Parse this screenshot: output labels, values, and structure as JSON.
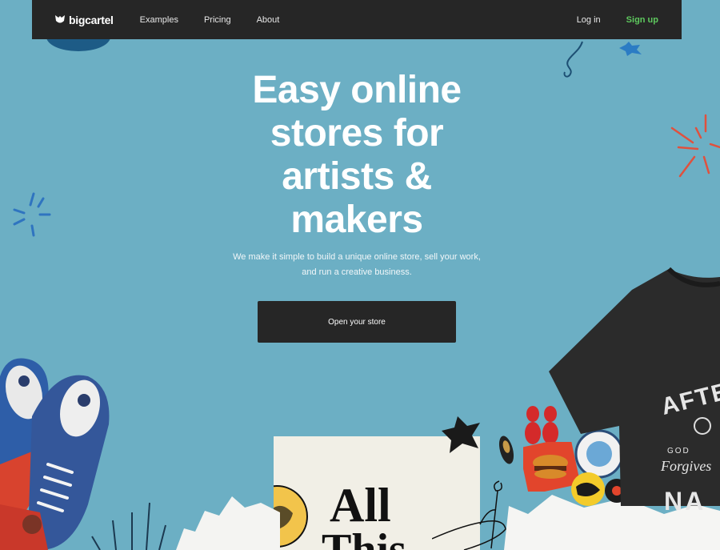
{
  "nav": {
    "logo_text": "bigcartel",
    "links": [
      "Examples",
      "Pricing",
      "About"
    ],
    "login": "Log in",
    "signup": "Sign up"
  },
  "hero": {
    "title_lines": [
      "Easy online",
      "stores for",
      "artists &",
      "makers"
    ],
    "subtitle_lines": [
      "We make it simple to build a unique online store, sell your work,",
      "and run a creative business."
    ],
    "cta": "Open your store"
  },
  "illustration": {
    "tshirt_text_1": "AFTE",
    "tshirt_text_2": "GOD",
    "tshirt_text_3": "Forgives",
    "tshirt_text_4": "NA",
    "poster_text_1": "All",
    "poster_text_2": "This"
  },
  "colors": {
    "background": "#6cafc4",
    "nav_bg": "#262626",
    "signup": "#5ec95e",
    "cta_bg": "#262626"
  }
}
